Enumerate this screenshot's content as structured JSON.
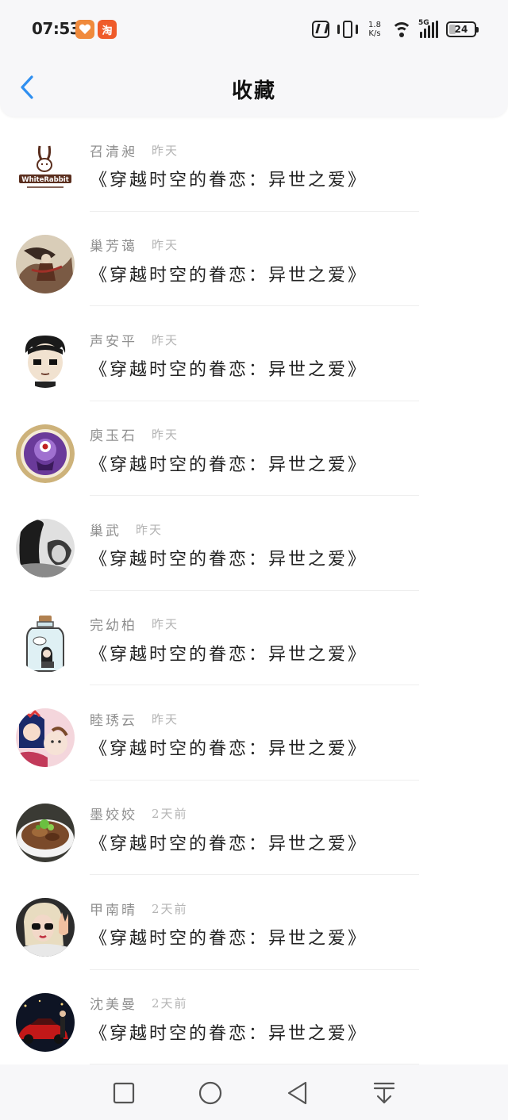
{
  "status_bar": {
    "time": "07:53",
    "app_icons": [
      "heart-app-icon",
      "taobao-icon"
    ],
    "taobao_glyph": "淘",
    "speed_value": "1.8",
    "speed_unit": "K/s",
    "network": "5G",
    "battery": "24"
  },
  "header": {
    "title": "收藏",
    "back_icon": "chevron-left-icon",
    "accent_color": "#2f8ff0"
  },
  "items": [
    {
      "name": "召清昶",
      "time": "昨天",
      "title": "《穿越时空的眷恋：异世之爱》",
      "avatar": "white-rabbit-logo"
    },
    {
      "name": "巢芳蔼",
      "time": "昨天",
      "title": "《穿越时空的眷恋：异世之爱》",
      "avatar": "ink-painting-figure"
    },
    {
      "name": "声安平",
      "time": "昨天",
      "title": "《穿越时空的眷恋：异世之爱》",
      "avatar": "cartoon-boy-face"
    },
    {
      "name": "庾玉石",
      "time": "昨天",
      "title": "《穿越时空的眷恋：异世之爱》",
      "avatar": "purple-monster-badge"
    },
    {
      "name": "巢武",
      "time": "昨天",
      "title": "《穿越时空的眷恋：异世之爱》",
      "avatar": "black-white-portrait"
    },
    {
      "name": "完幼柏",
      "time": "昨天",
      "title": "《穿越时空的眷恋：异世之爱》",
      "avatar": "girl-in-bottle"
    },
    {
      "name": "睦琇云",
      "time": "昨天",
      "title": "《穿越时空的眷恋：异世之爱》",
      "avatar": "selfie-with-child"
    },
    {
      "name": "墨姣姣",
      "time": "2天前",
      "title": "《穿越时空的眷恋：异世之爱》",
      "avatar": "food-bowl"
    },
    {
      "name": "甲南晴",
      "time": "2天前",
      "title": "《穿越时空的眷恋：异世之爱》",
      "avatar": "blonde-woman-glasses"
    },
    {
      "name": "沈美曼",
      "time": "2天前",
      "title": "《穿越时空的眷恋：异世之爱》",
      "avatar": "red-car-night"
    }
  ],
  "bottom_nav": [
    "recent-apps-square-icon",
    "home-circle-icon",
    "back-triangle-icon",
    "notification-pull-down-icon"
  ]
}
